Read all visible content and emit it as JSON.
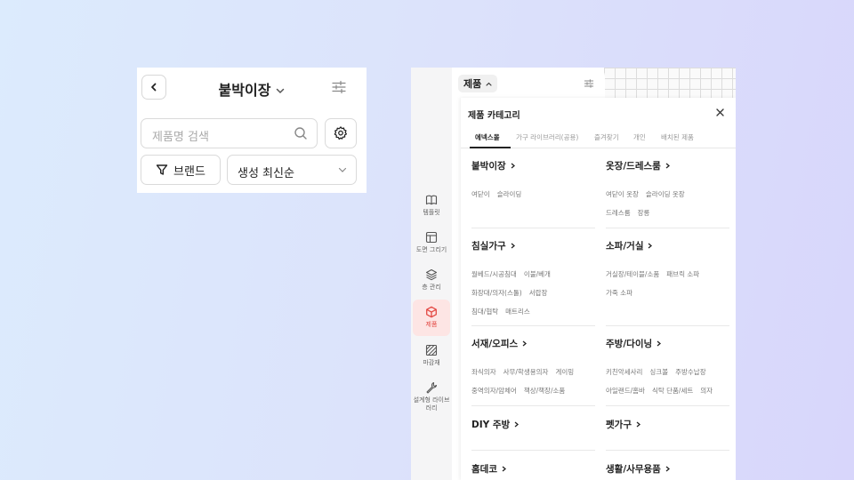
{
  "left_panel": {
    "title": "붙박이장",
    "search_placeholder": "제품명 검색",
    "brand_label": "브랜드",
    "sort_label": "생성 최신순"
  },
  "app": {
    "rail": [
      {
        "label": "템플릿",
        "icon": "book-icon"
      },
      {
        "label": "도면 그리기",
        "icon": "floorplan-icon"
      },
      {
        "label": "층 관리",
        "icon": "layers-icon"
      },
      {
        "label": "제품",
        "icon": "cube-icon",
        "active": true
      },
      {
        "label": "마감재",
        "icon": "texture-icon"
      },
      {
        "label": "설계형 라이브러리",
        "icon": "wrench-icon"
      }
    ],
    "chip_label": "제품",
    "category": {
      "title": "제품 카테고리",
      "tabs": [
        "에넥스몰",
        "가구 라이브러리(공용)",
        "즐겨찾기",
        "개인",
        "배치된 제품"
      ],
      "sections": [
        {
          "title": "붙박이장",
          "items": [
            "여닫이",
            "슬라이딩"
          ]
        },
        {
          "title": "옷장/드레스룸",
          "items": [
            "여닫이 옷장",
            "슬라이딩 옷장",
            "드레스룸",
            "장롱"
          ]
        },
        {
          "title": "침실가구",
          "items": [
            "월베드/시공침대",
            "이불/베개",
            "화장대/의자(스툴)",
            "서랍장",
            "침대/협탁",
            "매트리스"
          ]
        },
        {
          "title": "소파/거실",
          "items": [
            "거실장/테이블/소품",
            "패브릭 소파",
            "가죽 소파"
          ]
        },
        {
          "title": "서재/오피스",
          "items": [
            "좌식의자",
            "사무/학생용의자",
            "게이밍",
            "중역의자/암체어",
            "책상/책장/소품"
          ]
        },
        {
          "title": "주방/다이닝",
          "items": [
            "키친악세사리",
            "싱크볼",
            "주방수납장",
            "아일랜드/홈바",
            "식탁 단품/세트",
            "의자"
          ]
        },
        {
          "title": "DIY 주방",
          "items": []
        },
        {
          "title": "펫가구",
          "items": []
        },
        {
          "title": "홈데코",
          "items": []
        },
        {
          "title": "생활/사무용품",
          "items": []
        }
      ]
    }
  }
}
